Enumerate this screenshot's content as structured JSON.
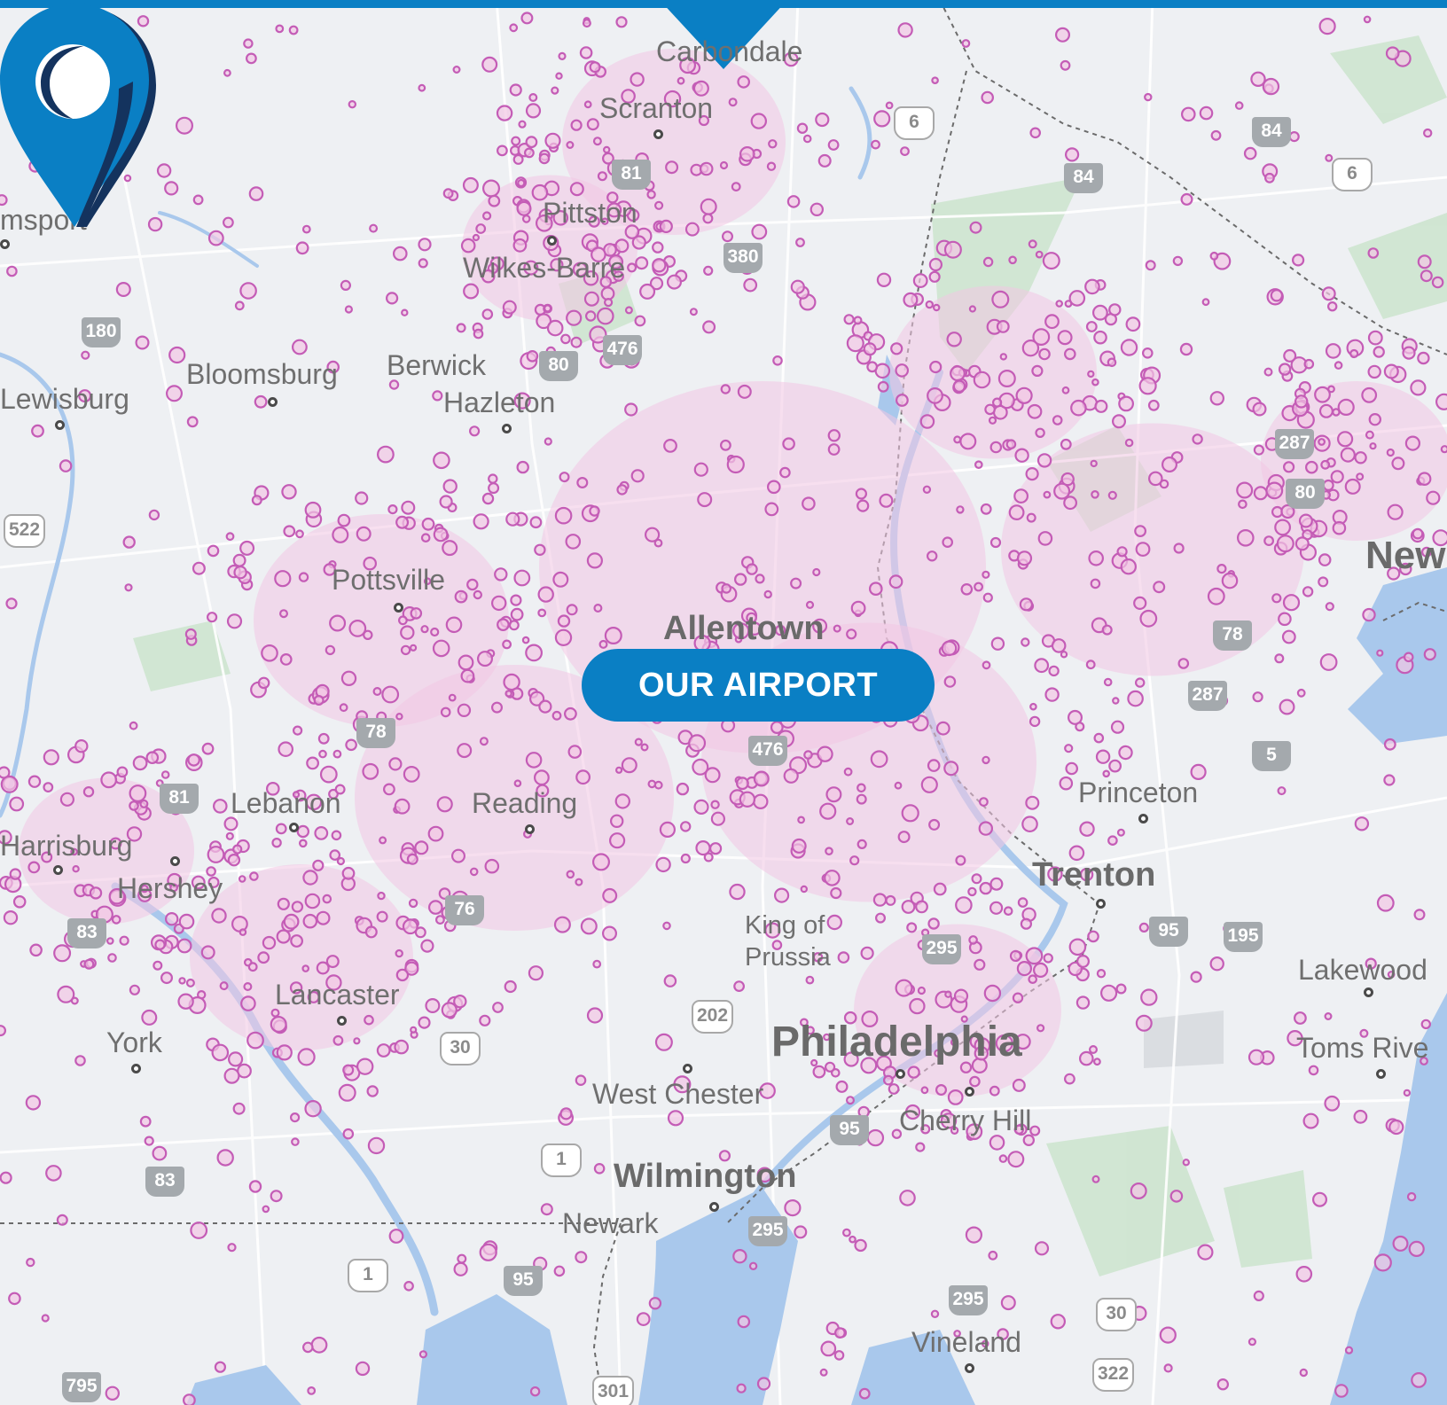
{
  "map": {
    "cities": [
      {
        "key": "carbondale",
        "label": "Carbondale"
      },
      {
        "key": "scranton",
        "label": "Scranton"
      },
      {
        "key": "pittston",
        "label": "Pittston"
      },
      {
        "key": "wilkes_barre",
        "label": "Wilkes-Barre"
      },
      {
        "key": "williamsport",
        "label": "msport"
      },
      {
        "key": "bloomsburg",
        "label": "Bloomsburg"
      },
      {
        "key": "berwick",
        "label": "Berwick"
      },
      {
        "key": "hazleton",
        "label": "Hazleton"
      },
      {
        "key": "lewisburg",
        "label": "Lewisburg"
      },
      {
        "key": "pottsville",
        "label": "Pottsville"
      },
      {
        "key": "allentown",
        "label": "Allentown"
      },
      {
        "key": "new_york",
        "label": "New"
      },
      {
        "key": "princeton",
        "label": "Princeton"
      },
      {
        "key": "lebanon",
        "label": "Lebanon"
      },
      {
        "key": "reading",
        "label": "Reading"
      },
      {
        "key": "harrisburg",
        "label": "Harrisburg"
      },
      {
        "key": "hershey",
        "label": "Hershey"
      },
      {
        "key": "trenton",
        "label": "Trenton"
      },
      {
        "key": "king_of_prussia_1",
        "label": "King of"
      },
      {
        "key": "king_of_prussia_2",
        "label": "Prussia"
      },
      {
        "key": "lakewood",
        "label": "Lakewood"
      },
      {
        "key": "lancaster",
        "label": "Lancaster"
      },
      {
        "key": "york",
        "label": "York"
      },
      {
        "key": "philadelphia",
        "label": "Philadelphia"
      },
      {
        "key": "toms_river",
        "label": "Toms Rive"
      },
      {
        "key": "west_chester",
        "label": "West Chester"
      },
      {
        "key": "cherry_hill",
        "label": "Cherry Hill"
      },
      {
        "key": "wilmington",
        "label": "Wilmington"
      },
      {
        "key": "newark",
        "label": "Newark"
      },
      {
        "key": "vineland",
        "label": "Vineland"
      }
    ],
    "highways": [
      {
        "key": "i81",
        "label": "81",
        "type": "interstate"
      },
      {
        "key": "i84",
        "label": "84",
        "type": "interstate"
      },
      {
        "key": "us6_ny",
        "label": "6",
        "type": "us"
      },
      {
        "key": "us6_pa",
        "label": "6",
        "type": "us"
      },
      {
        "key": "i84b",
        "label": "84",
        "type": "interstate"
      },
      {
        "key": "i380",
        "label": "380",
        "type": "interstate"
      },
      {
        "key": "i180",
        "label": "180",
        "type": "interstate"
      },
      {
        "key": "i80",
        "label": "80",
        "type": "interstate"
      },
      {
        "key": "i476",
        "label": "476",
        "type": "interstate"
      },
      {
        "key": "i287",
        "label": "287",
        "type": "interstate"
      },
      {
        "key": "i80_nj",
        "label": "80",
        "type": "interstate"
      },
      {
        "key": "us522",
        "label": "522",
        "type": "us"
      },
      {
        "key": "i78_pa",
        "label": "78",
        "type": "interstate"
      },
      {
        "key": "i78_nj",
        "label": "78",
        "type": "interstate"
      },
      {
        "key": "i287b",
        "label": "287",
        "type": "interstate"
      },
      {
        "key": "i81b",
        "label": "81",
        "type": "interstate"
      },
      {
        "key": "i76",
        "label": "76",
        "type": "interstate"
      },
      {
        "key": "i476b",
        "label": "476",
        "type": "interstate"
      },
      {
        "key": "i95_nj",
        "label": "95",
        "type": "interstate"
      },
      {
        "key": "i195",
        "label": "195",
        "type": "interstate"
      },
      {
        "key": "i295",
        "label": "295",
        "type": "interstate"
      },
      {
        "key": "i83",
        "label": "83",
        "type": "interstate"
      },
      {
        "key": "i295b",
        "label": "295",
        "type": "interstate"
      },
      {
        "key": "us202",
        "label": "202",
        "type": "us"
      },
      {
        "key": "us30_pa",
        "label": "30",
        "type": "us"
      },
      {
        "key": "i95_pa",
        "label": "95",
        "type": "interstate"
      },
      {
        "key": "us1",
        "label": "1",
        "type": "us"
      },
      {
        "key": "i83b",
        "label": "83",
        "type": "interstate"
      },
      {
        "key": "i295c",
        "label": "295",
        "type": "interstate"
      },
      {
        "key": "us1b",
        "label": "1",
        "type": "us"
      },
      {
        "key": "i95_de",
        "label": "95",
        "type": "interstate"
      },
      {
        "key": "us30_nj",
        "label": "30",
        "type": "us"
      },
      {
        "key": "us322",
        "label": "322",
        "type": "us"
      },
      {
        "key": "i795",
        "label": "795",
        "type": "interstate"
      },
      {
        "key": "us301",
        "label": "301",
        "type": "us"
      },
      {
        "key": "i5_nj",
        "label": "5",
        "type": "interstate"
      }
    ],
    "marker": {
      "label": "OUR AIRPORT",
      "icon": "location-pin-icon"
    },
    "colors": {
      "accent": "#0a7fc4",
      "coverage_fill": "#f2c6e4",
      "coverage_stroke": "#c45cb6",
      "water": "#a9c8ec",
      "park": "#c9e3cb",
      "land": "#eef0f3"
    }
  }
}
